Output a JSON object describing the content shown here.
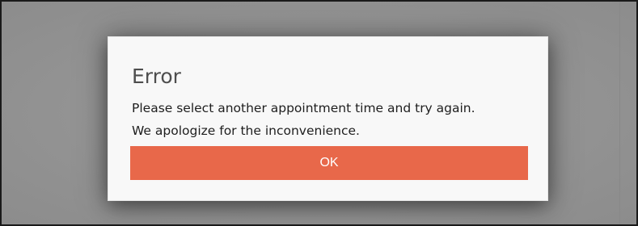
{
  "dialog": {
    "title": "Error",
    "message_line1": "Please select another appointment time and try again.",
    "message_line2": "We apologize for the inconvenience.",
    "ok_label": "OK"
  },
  "colors": {
    "overlay": "#8f8f8f",
    "dialog_background": "#f8f8f8",
    "ok_button": "#e8684a",
    "ok_button_text": "#ffffff",
    "title_text": "#4e4e4e"
  }
}
